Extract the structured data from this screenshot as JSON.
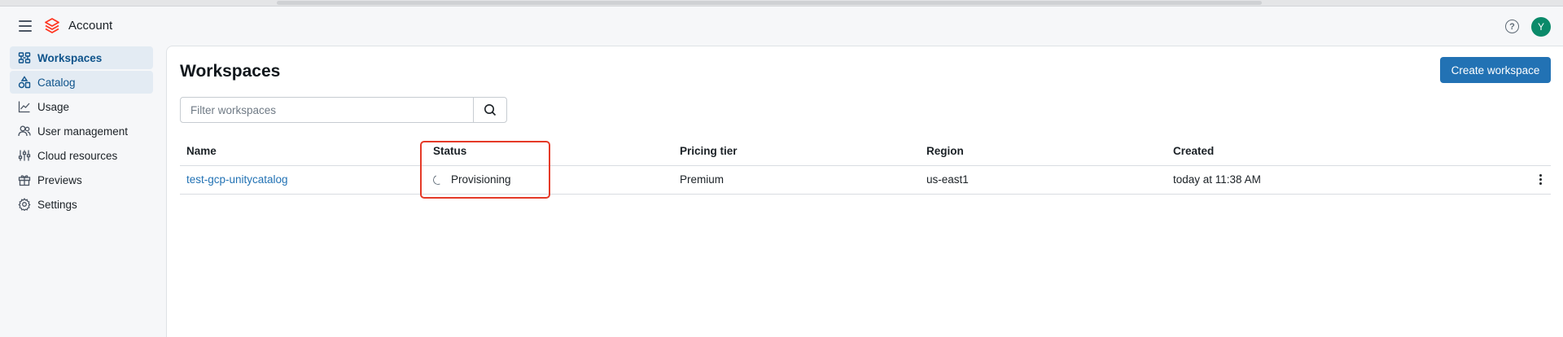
{
  "app": {
    "title": "Account",
    "user_initial": "Y",
    "help_label": "?",
    "brand_color": "#ff3621",
    "accent_color": "#2272b4"
  },
  "sidebar": {
    "items": [
      {
        "label": "Workspaces",
        "icon": "workspaces-icon",
        "state": "active"
      },
      {
        "label": "Catalog",
        "icon": "catalog-icon",
        "state": "selected"
      },
      {
        "label": "Usage",
        "icon": "usage-chart-icon",
        "state": "default"
      },
      {
        "label": "User management",
        "icon": "users-icon",
        "state": "default"
      },
      {
        "label": "Cloud resources",
        "icon": "cloud-resources-icon",
        "state": "default"
      },
      {
        "label": "Previews",
        "icon": "gift-icon",
        "state": "default"
      },
      {
        "label": "Settings",
        "icon": "gear-icon",
        "state": "default"
      }
    ]
  },
  "main": {
    "title": "Workspaces",
    "create_button": "Create workspace",
    "filter": {
      "placeholder": "Filter workspaces",
      "value": ""
    },
    "table": {
      "columns": [
        "Name",
        "Status",
        "Pricing tier",
        "Region",
        "Created"
      ],
      "rows": [
        {
          "name": "test-gcp-unitycatalog",
          "status": "Provisioning",
          "pricing_tier": "Premium",
          "region": "us-east1",
          "created": "today at 11:38 AM"
        }
      ]
    }
  }
}
